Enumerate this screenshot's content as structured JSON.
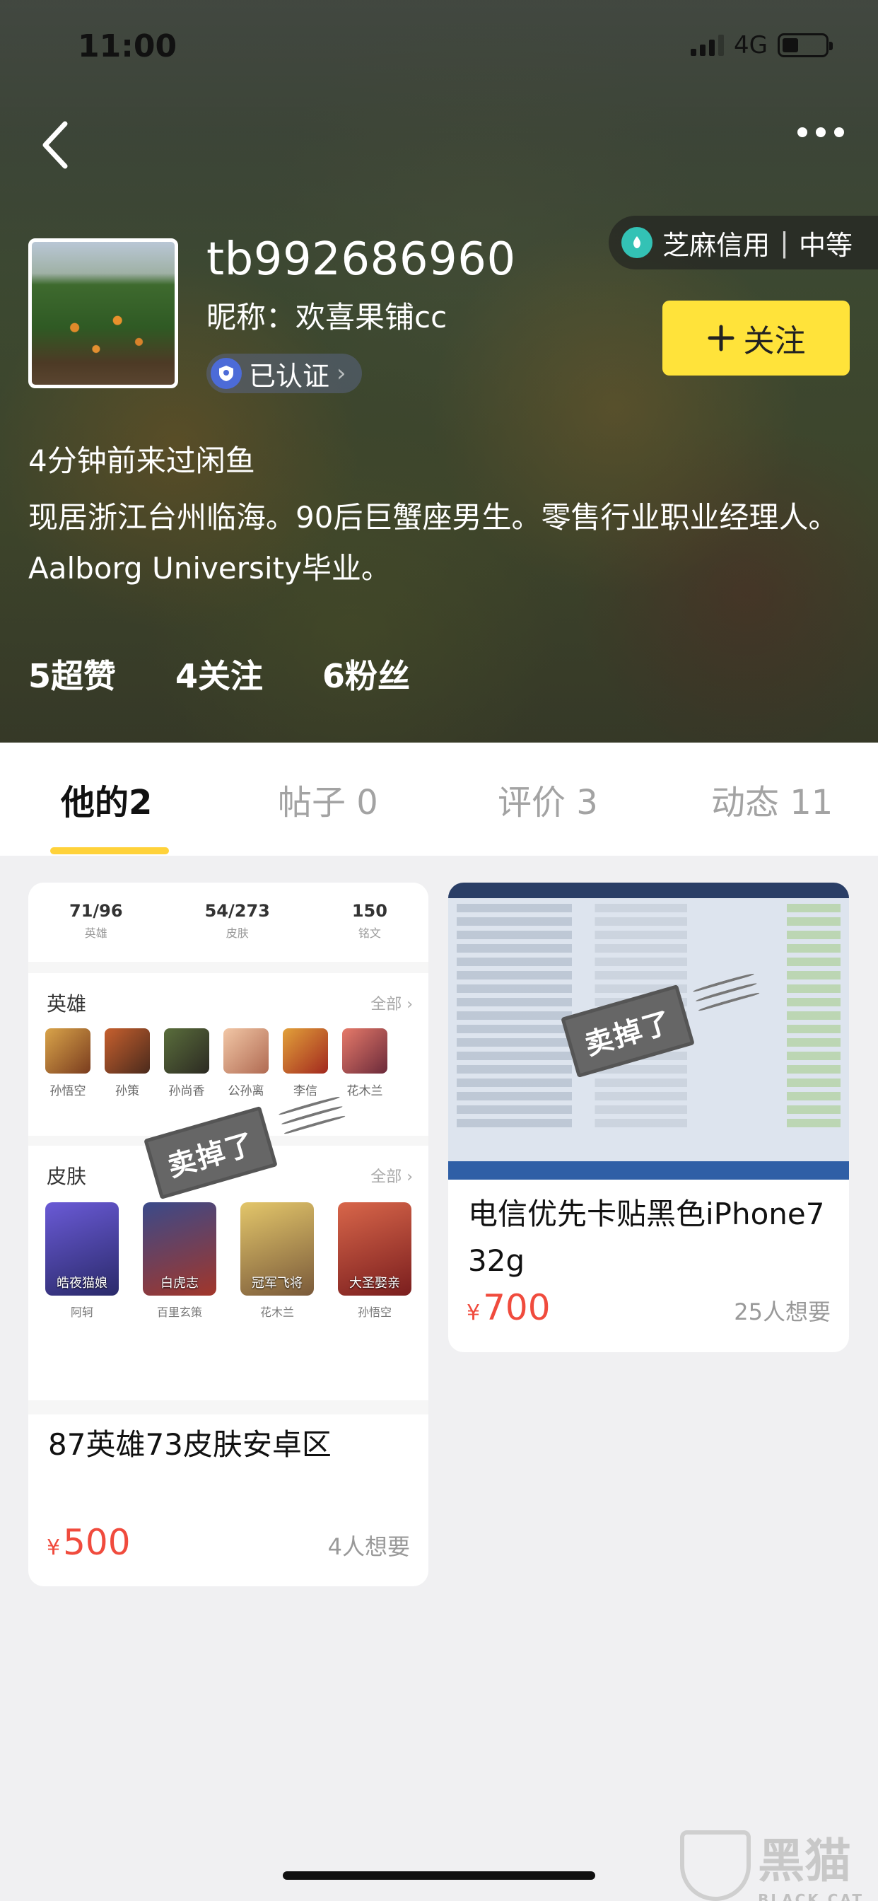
{
  "status_bar": {
    "time": "11:00",
    "network": "4G"
  },
  "profile": {
    "username": "tb992686960",
    "nickname": "昵称：欢喜果铺cc",
    "verified_label": "已认证",
    "credit_label": "芝麻信用",
    "credit_level": "中等",
    "follow_label": "关注",
    "last_visit": "4分钟前来过闲鱼",
    "bio": "现居浙江台州临海。90后巨蟹座男生。零售行业职业经理人。Aalborg University毕业。",
    "stats": {
      "likes": "5超赞",
      "following": "4关注",
      "followers": "6粉丝"
    }
  },
  "tabs": [
    {
      "label": "他的2",
      "active": true
    },
    {
      "label": "帖子 0",
      "active": false
    },
    {
      "label": "评价 3",
      "active": false
    },
    {
      "label": "动态 11",
      "active": false
    }
  ],
  "items": [
    {
      "title": "87英雄73皮肤安卓区",
      "currency": "¥",
      "price": "500",
      "wants": "4人想要",
      "sold_stamp": "卖掉了",
      "preview": {
        "stats": [
          {
            "value": "71/96",
            "label": "英雄"
          },
          {
            "value": "54/273",
            "label": "皮肤"
          },
          {
            "value": "150",
            "label": "铭文"
          }
        ],
        "heroes_title": "英雄",
        "skins_title": "皮肤",
        "all_label": "全部 ›",
        "heroes": [
          "孙悟空",
          "孙策",
          "孙尚香",
          "公孙离",
          "李信",
          "花木兰"
        ],
        "skins": [
          "皓夜猫娘",
          "白虎志",
          "冠军飞将",
          "大圣娶亲"
        ],
        "skin_heroes": [
          "阿轲",
          "百里玄策",
          "花木兰",
          "孙悟空"
        ]
      }
    },
    {
      "title": "电信优先卡贴黑色iPhone7 32g",
      "currency": "¥",
      "price": "700",
      "wants": "25人想要",
      "sold_stamp": "卖掉了"
    }
  ],
  "watermark": {
    "cn": "黑猫",
    "en": "BLACK CAT"
  },
  "colors": {
    "accent_yellow": "#ffe33a",
    "price_red": "#f04b3d",
    "tab_underline": "#ffd23a"
  }
}
